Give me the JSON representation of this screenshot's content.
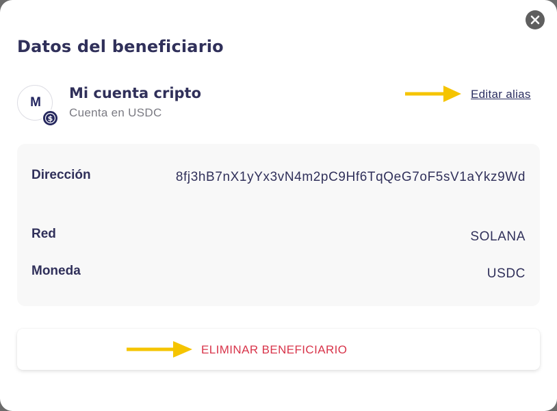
{
  "modal": {
    "title": "Datos del beneficiario"
  },
  "account": {
    "avatar_initial": "M",
    "name": "Mi cuenta cripto",
    "subtitle": "Cuenta en USDC",
    "edit_link": "Editar alias",
    "coin_icon": "usdc-coin-icon"
  },
  "details": {
    "address_label": "Dirección",
    "address_value": "8fj3hB7nX1yYx3vN4m2pC9Hf6TqQeG7oF5sV1aYkz9Wd",
    "network_label": "Red",
    "network_value": "SOLANA",
    "currency_label": "Moneda",
    "currency_value": "USDC"
  },
  "actions": {
    "delete_label": "ELIMINAR BENEFICIARIO"
  },
  "colors": {
    "annotation_arrow": "#f5c400",
    "danger": "#d8344a",
    "heading": "#30305a"
  }
}
